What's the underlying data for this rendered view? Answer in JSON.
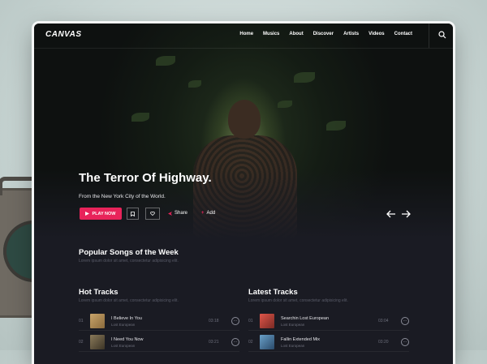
{
  "app": {
    "logo": "CANVAS"
  },
  "nav": {
    "items": [
      "Home",
      "Musics",
      "About",
      "Discover",
      "Artists",
      "Videos",
      "Contact"
    ]
  },
  "hero": {
    "title": "The Terror Of Highway.",
    "subtitle": "From the New York City of the World.",
    "play_label": "PLAY NOW",
    "share_label": "Share",
    "add_label": "Add"
  },
  "popular": {
    "title": "Popular Songs of the Week",
    "subtitle": "Lorem ipsum dolor sit amet, consectetur adipisicing elit."
  },
  "hot_tracks": {
    "title": "Hot Tracks",
    "subtitle": "Lorem ipsum dolor sit amet, consectetur adipisicing elit.",
    "rows": [
      {
        "num": "01",
        "title": "I Believe In You",
        "artist": "Lost European",
        "duration": "03:18"
      },
      {
        "num": "02",
        "title": "I Need You Now",
        "artist": "Lost European",
        "duration": "03:21"
      }
    ]
  },
  "latest_tracks": {
    "title": "Latest Tracks",
    "subtitle": "Lorem ipsum dolor sit amet, consectetur adipisicing elit.",
    "rows": [
      {
        "num": "01",
        "title": "Searchin Lost European",
        "artist": "Lost European",
        "duration": "03:04"
      },
      {
        "num": "02",
        "title": "Fallin Extended Mix",
        "artist": "Lost European",
        "duration": "03:20"
      }
    ]
  },
  "colors": {
    "accent": "#e8235a",
    "background": "#1a1b23"
  },
  "icons": [
    "search-icon",
    "play-icon",
    "bookmark-icon",
    "heart-icon",
    "share-icon",
    "plus-icon",
    "arrow-left-icon",
    "arrow-right-icon",
    "more-icon"
  ]
}
